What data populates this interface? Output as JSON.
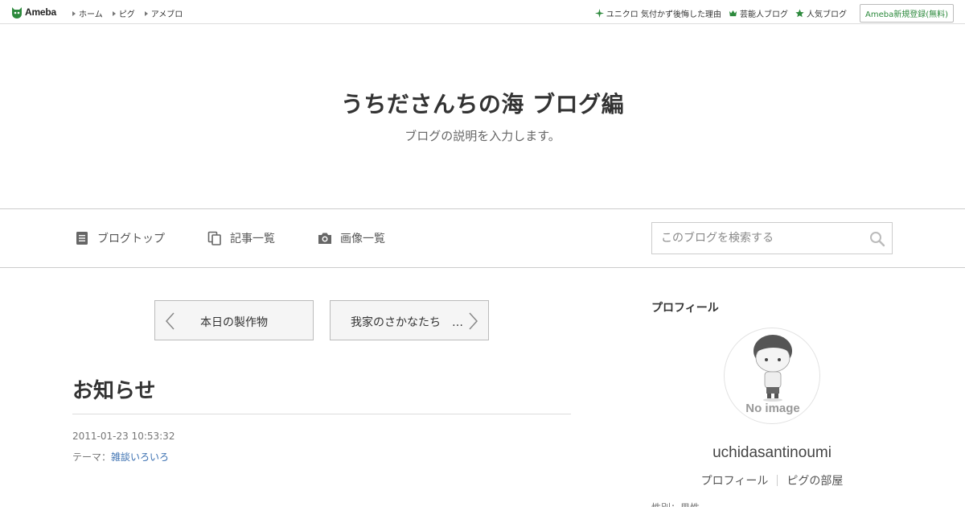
{
  "topbar": {
    "logo_text": "Ameba",
    "nav": [
      {
        "label": "ホーム"
      },
      {
        "label": "ピグ"
      },
      {
        "label": "アメブロ"
      }
    ],
    "links": [
      {
        "label": "ユニクロ 気付かず後悔した理由",
        "icon": "sparkle-icon"
      },
      {
        "label": "芸能人ブログ",
        "icon": "crown-icon"
      },
      {
        "label": "人気ブログ",
        "icon": "star-icon"
      }
    ],
    "register_label": "Ameba新規登録(無料)"
  },
  "header": {
    "title": "うちださんちの海 ブログ編",
    "description": "ブログの説明を入力します。"
  },
  "gnav": {
    "items": [
      {
        "label": "ブログトップ",
        "icon": "document-icon"
      },
      {
        "label": "記事一覧",
        "icon": "copy-icon"
      },
      {
        "label": "画像一覧",
        "icon": "camera-icon"
      }
    ],
    "search_placeholder": "このブログを検索する"
  },
  "pager": {
    "prev_label": "本日の製作物",
    "next_label": "我家のさかなたち　…"
  },
  "article": {
    "title": "お知らせ",
    "date": "2011-01-23 10:53:32",
    "theme_prefix": "テーマ：",
    "theme_link": "雑談いろいろ"
  },
  "sidebar": {
    "heading": "プロフィール",
    "avatar_text": "No image",
    "username": "uchidasantinoumi",
    "profile_link": "プロフィール",
    "room_link": "ピグの部屋",
    "cutoff_text": "性別：男性"
  },
  "colors": {
    "brand_green": "#2d8a3d",
    "link_blue": "#3a6fb0",
    "border": "#cccccc"
  }
}
